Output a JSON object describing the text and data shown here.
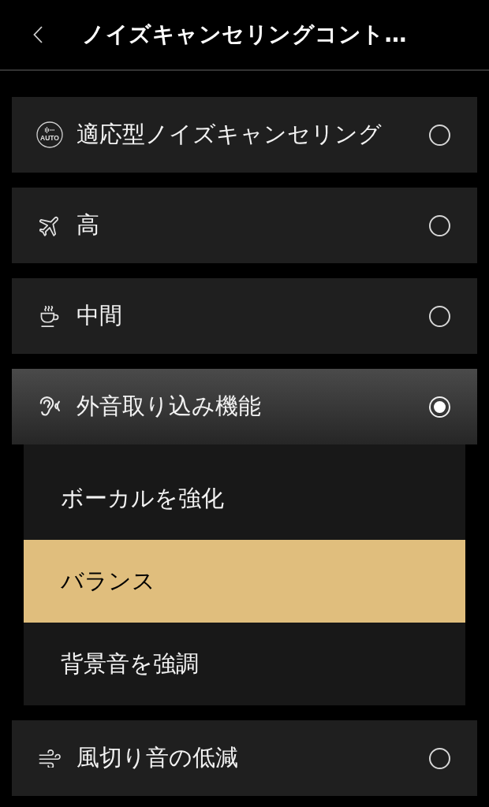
{
  "header": {
    "title": "ノイズキャンセリングコント…"
  },
  "modes": [
    {
      "label": "適応型ノイズキャンセリング",
      "icon_text": "AUTO",
      "selected": false
    },
    {
      "label": "高",
      "selected": false
    },
    {
      "label": "中間",
      "selected": false
    },
    {
      "label": "外音取り込み機能",
      "selected": true,
      "options": [
        {
          "label": "ボーカルを強化",
          "selected": false
        },
        {
          "label": "バランス",
          "selected": true
        },
        {
          "label": "背景音を強調",
          "selected": false
        }
      ]
    },
    {
      "label": "風切り音の低減",
      "selected": false
    }
  ]
}
